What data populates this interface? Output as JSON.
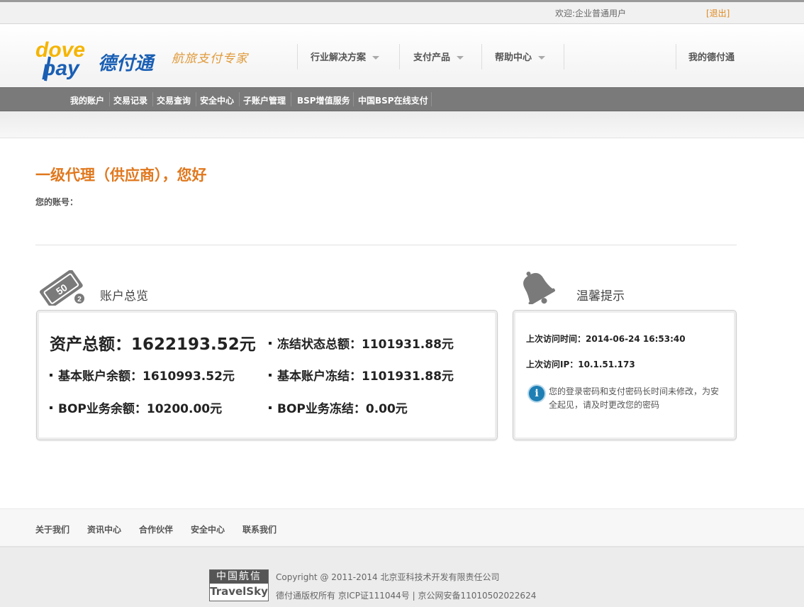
{
  "topbar": {
    "welcome": "欢迎:企业普通用户",
    "logout": "[退出]"
  },
  "header": {
    "logo_text": "dove pay 德付通",
    "slogan": "航旅支付专家",
    "nav": [
      {
        "label": "行业解决方案"
      },
      {
        "label": "支付产品"
      },
      {
        "label": "帮助中心"
      }
    ],
    "my_account": "我的德付通"
  },
  "subnav": {
    "items": [
      {
        "label": "我的账户"
      },
      {
        "label": "交易记录"
      },
      {
        "label": "交易查询"
      },
      {
        "label": "安全中心"
      },
      {
        "label": "子账户管理"
      },
      {
        "label": "BSP增值服务"
      },
      {
        "label": "中国BSP在线支付"
      }
    ]
  },
  "main": {
    "greeting": "一级代理（供应商），您好",
    "account_label": "您的账号："
  },
  "overview": {
    "title": "账户总览",
    "total_assets": "资产总额：1622193.52元",
    "frozen_total": "冻结状态总额：1101931.88元",
    "basic_balance": "基本账户余额：1610993.52元",
    "basic_frozen": "基本账户冻结：1101931.88元",
    "bop_balance": "BOP业务余额：10200.00元",
    "bop_frozen": "BOP业务冻结：0.00元"
  },
  "tips": {
    "title": "温馨提示",
    "last_visit_time": "上次访问时间：2014-06-24 16:53:40",
    "last_visit_ip": "上次访问IP：10.1.51.173",
    "security_notice": "您的登录密码和支付密码长时间未修改，为安全起见，请及时更改您的密码"
  },
  "footer": {
    "links": [
      {
        "label": "关于我们"
      },
      {
        "label": "资讯中心"
      },
      {
        "label": "合作伙伴"
      },
      {
        "label": "安全中心"
      },
      {
        "label": "联系我们"
      }
    ],
    "travelsky_cn": "中国航信",
    "travelsky_en": "TravelSky",
    "copyright": "Copyright @ 2011-2014 北京亚科技术开发有限责任公司",
    "license": "德付通版权所有 京ICP证111044号 | 京公网安备11010502022624"
  },
  "colors": {
    "accent_orange": "#e0781e",
    "subnav_gray": "#7a7a7a",
    "info_blue": "#1e7fb4",
    "logo_yellow": "#f5b400",
    "logo_blue": "#1a5fb4"
  }
}
